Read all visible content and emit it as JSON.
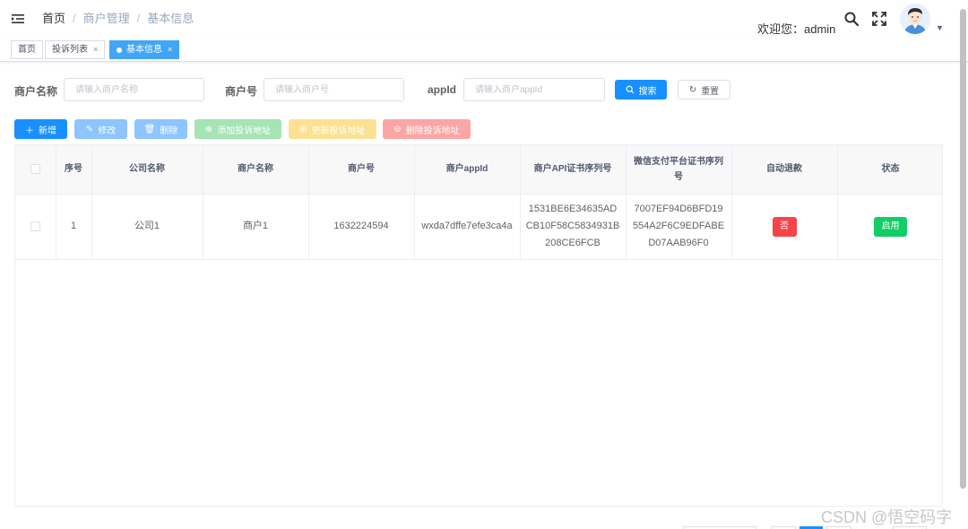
{
  "navbar": {
    "breadcrumb": [
      "首页",
      "商户管理",
      "基本信息"
    ],
    "separator": "/",
    "welcome": "欢迎您：admin",
    "icons": [
      "hamburger-icon",
      "search-icon",
      "fullscreen-icon",
      "avatar",
      "caret-down-icon"
    ]
  },
  "tags": [
    {
      "label": "首页",
      "closable": false,
      "active": false
    },
    {
      "label": "投诉列表",
      "closable": true,
      "active": false
    },
    {
      "label": "基本信息",
      "closable": true,
      "active": true
    }
  ],
  "tag_close": "×",
  "search": {
    "merchant_name": {
      "label": "商户名称",
      "placeholder": "请输入商户名称",
      "value": ""
    },
    "merchant_no": {
      "label": "商户号",
      "placeholder": "请输入商户号",
      "value": ""
    },
    "app_id": {
      "label": "appId",
      "placeholder": "请输入商户appId",
      "value": ""
    },
    "search_button": "搜索",
    "reset_button": "重置"
  },
  "toolbar": {
    "add": "新增",
    "edit": "修改",
    "delete": "删除",
    "add_complaint": "添加投诉地址",
    "update_complaint": "更新投诉地址",
    "delete_complaint": "删除投诉地址"
  },
  "table": {
    "columns": [
      "",
      "序号",
      "公司名称",
      "商户名称",
      "商户号",
      "商户appId",
      "商户API证书序列号",
      "微信支付平台证书序列号",
      "自动退款",
      "状态"
    ],
    "rows": [
      {
        "index": "1",
        "company": "公司1",
        "merchant_name": "商户1",
        "merchant_no": "1632224594",
        "app_id": "wxda7dffe7efe3ca4a",
        "api_cert_serial": "1531BE6E34635ADCB10F58C5834931B208CE6FCB",
        "platform_cert_serial": "7007EF94D6BFD19554A2F6C9EDFABED07AAB96F0",
        "auto_refund": "否",
        "status": "启用"
      }
    ]
  },
  "watermark": "CSDN @悟空码字",
  "colors": {
    "primary": "#1890ff",
    "danger": "#f5444a",
    "success": "#13ce66",
    "tag_active": "#42a5f5"
  }
}
